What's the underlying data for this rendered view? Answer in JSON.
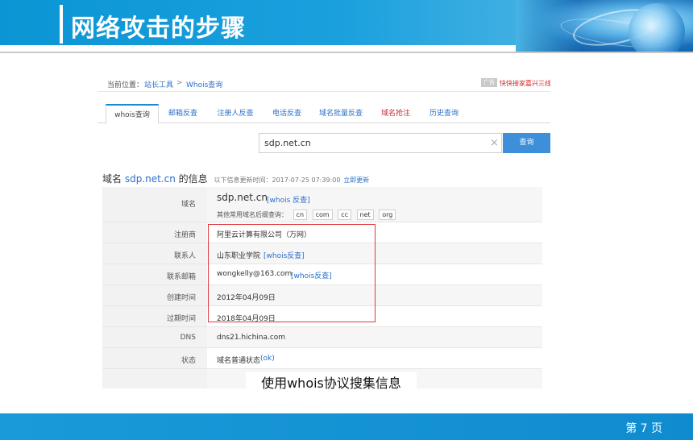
{
  "slide": {
    "title": "网络攻击的步骤",
    "caption": "使用whois协议搜集信息",
    "page_number": "第 7 页"
  },
  "breadcrumb": {
    "label": "当前位置：",
    "items": [
      "站长工具",
      "Whois查询"
    ],
    "separator": ">"
  },
  "promo": {
    "badge": "广告",
    "text": "快快接家嘉兴三线"
  },
  "tabs": [
    {
      "label": "whois查询",
      "active": true
    },
    {
      "label": "邮箱反查"
    },
    {
      "label": "注册人反查"
    },
    {
      "label": "电话反查"
    },
    {
      "label": "域名批量反查"
    },
    {
      "label": "域名抢注",
      "hot": true
    },
    {
      "label": "历史查询"
    }
  ],
  "search": {
    "value": "sdp.net.cn",
    "button_label": "查询"
  },
  "info": {
    "prefix": "域名 ",
    "domain": "sdp.net.cn",
    "suffix": " 的信息",
    "update_note": "以下信息更新时间：2017-07-25 07:39:00",
    "update_link": "立即更新"
  },
  "rows": {
    "domain": {
      "label": "域名",
      "value": "sdp.net.cn",
      "link": "[whois 反查]",
      "suffix_label": "其他常用域名后缀查询：",
      "suffixes": [
        "cn",
        "com",
        "cc",
        "net",
        "org"
      ]
    },
    "registrar": {
      "label": "注册商",
      "value": "阿里云计算有限公司（万网）"
    },
    "contact": {
      "label": "联系人",
      "value": "山东职业学院",
      "link": "[whois反查]"
    },
    "email": {
      "label": "联系邮箱",
      "value": "wongkelly@163.com",
      "link": "[whois反查]"
    },
    "created": {
      "label": "创建时间",
      "value": "2012年04月09日"
    },
    "expires": {
      "label": "过期时间",
      "value": "2018年04月09日"
    },
    "dns": {
      "label": "DNS",
      "value": "dns21.hichina.com"
    },
    "status": {
      "label": "状态",
      "value": "域名普通状态",
      "link": "(ok)"
    }
  },
  "colors": {
    "header_blue": "#0b95d4",
    "link_blue": "#2a6fc9",
    "highlight_red": "#e0383d",
    "footer_blue": "#1a9ad8"
  }
}
